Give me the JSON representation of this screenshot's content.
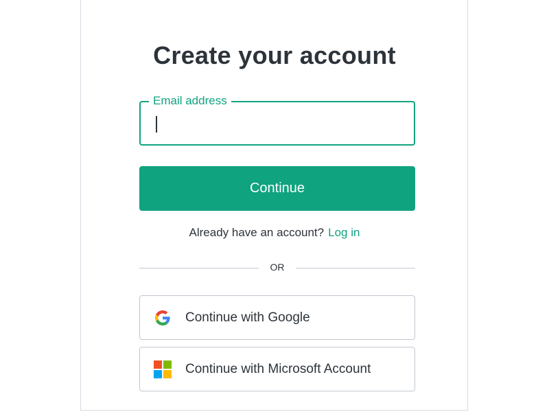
{
  "title": "Create your account",
  "email": {
    "label": "Email address",
    "value": "",
    "placeholder": ""
  },
  "primary_button": "Continue",
  "login_prompt": {
    "text": "Already have an account?",
    "link": "Log in"
  },
  "divider_text": "OR",
  "social_buttons": [
    {
      "label": "Continue with Google",
      "icon": "google-icon"
    },
    {
      "label": "Continue with Microsoft Account",
      "icon": "microsoft-icon"
    }
  ],
  "colors": {
    "accent": "#10a37f",
    "text": "#2d333a",
    "border": "#c2c8d0",
    "ms_red": "#f25022",
    "ms_green": "#7fba00",
    "ms_blue": "#00a4ef",
    "ms_yellow": "#ffb900"
  }
}
